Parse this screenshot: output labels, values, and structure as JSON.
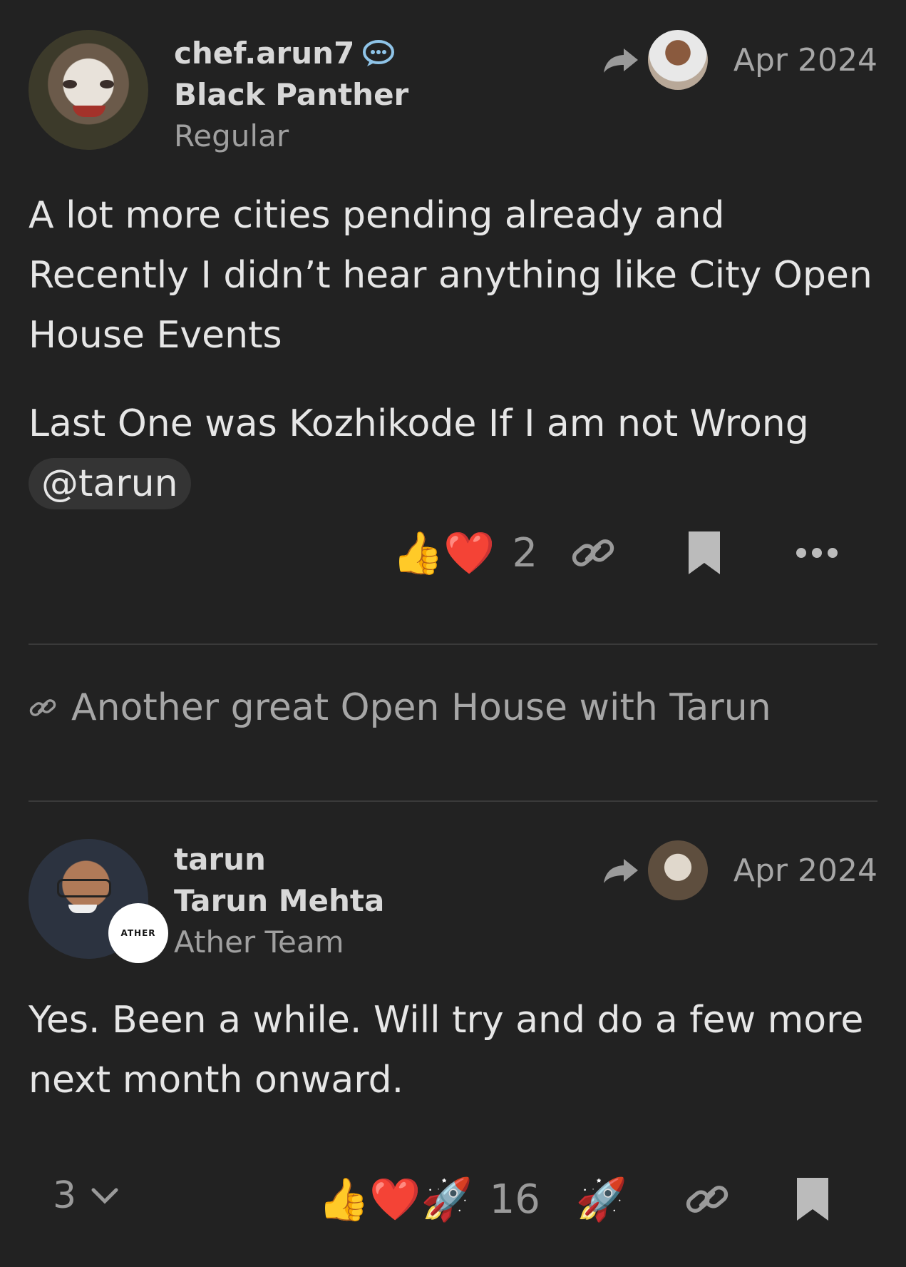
{
  "posts": [
    {
      "username": "chef.arun7",
      "full_name": "Black Panther",
      "user_title": "Regular",
      "date": "Apr 2024",
      "avatar_icon": "joker-avatar",
      "reply_to_avatar": "man-avatar",
      "body": [
        "A lot more cities pending already and Recently I didn’t hear anything like City Open House Events",
        "Last One was Kozhikode If I am not Wrong"
      ],
      "mention": "@tarun",
      "reactions": {
        "emojis": [
          "👍",
          "❤️"
        ],
        "count": "2"
      }
    },
    {
      "username": "tarun",
      "full_name": "Tarun Mehta",
      "user_title": "Ather Team",
      "badge": "ATHER",
      "date": "Apr 2024",
      "avatar_icon": "tarun-avatar",
      "reply_to_avatar": "joker-avatar",
      "body": [
        "Yes. Been a while. Will try and do a few more next month onward."
      ],
      "reactions": {
        "emojis": [
          "👍",
          "❤️",
          "🚀"
        ],
        "count": "16"
      },
      "replies_count": "3"
    }
  ],
  "linked_topic": "Another great Open House with Tarun",
  "colors": {
    "background": "#222222",
    "text": "#dddddd",
    "muted": "#9a9a9a",
    "heart": "#e0252f"
  }
}
